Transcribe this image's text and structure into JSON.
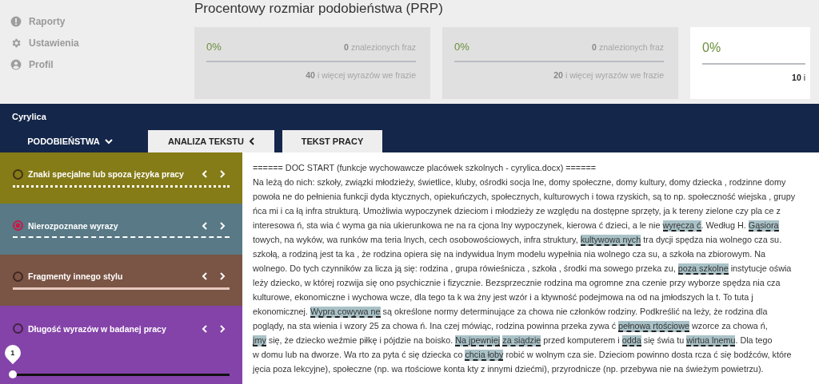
{
  "sidebar": {
    "items": [
      {
        "label": "Raporty"
      },
      {
        "label": "Ustawienia"
      },
      {
        "label": "Profil"
      }
    ]
  },
  "prp": {
    "title": "Procentowy rozmiar podobieństwa (PRP)",
    "cards": [
      {
        "percent": "0%",
        "found_count": "0",
        "found_label": "znalezionych fraz",
        "min_words": "40",
        "min_label": "i więcej wyrazów we frazie",
        "selected": false
      },
      {
        "percent": "0%",
        "found_count": "0",
        "found_label": "znalezionych fraz",
        "min_words": "20",
        "min_label": "i więcej wyrazów we frazie",
        "selected": false
      },
      {
        "percent": "0%",
        "min_words": "10",
        "min_label": "i",
        "selected": true
      }
    ]
  },
  "band": {
    "title": "Cyrylica"
  },
  "tabs": [
    {
      "label": "PODOBIEŃSTWA",
      "selected": true
    },
    {
      "label": "ANALIZA TEKSTU",
      "selected": false
    },
    {
      "label": "TEKST PRACY",
      "selected": false
    }
  ],
  "categories": [
    {
      "kind": "line",
      "label": "Znaki specjalne lub spoza języka pracy",
      "color": "#857b17",
      "selected": false
    },
    {
      "kind": "line",
      "label": "Nierozpoznane wyrazy",
      "color": "#587985",
      "selected": true
    },
    {
      "kind": "line",
      "label": "Fragmenty innego stylu",
      "color": "#7a5444",
      "selected": false
    },
    {
      "kind": "slider",
      "label": "Długość wyrazów w badanej pracy",
      "color": "#8443a9",
      "thumb_label": "1",
      "level": 0,
      "selected": false
    }
  ],
  "document": {
    "lines": [
      [
        {
          "t": "====== DOC START (funkcje wychowawcze placówek szkolnych - cyrylica.docx) ======"
        }
      ],
      [
        {
          "t": "Na leżą do nich: szkoły, związki młodzieży, świetlice, kluby, ośrodki socja lne, domy społeczne, domy kultury, domy dziecka , rodzinne domy"
        }
      ],
      [
        {
          "t": "powoła ne do pełnienia funkcji dyda ktycznych, opiekuńczych, społecznych, kulturowych i towa rzyskich, są to np. społeczność wiejska , grupy"
        }
      ],
      [
        {
          "t": "ńca mi i ca łą infra strukturą. Umożliwia wypoczynek dzieciom i młodzieży ze względu na dostępne sprzęty, ja k tereny zielone czy pla ce z"
        }
      ],
      [
        {
          "t": "interesowa ń, sta wia ć wyma ga nia ukierunkowa ne na ra cjona lny wypoczynek, kierowa ć dzieci, a le nie "
        },
        {
          "t": "wyręcza ć",
          "hl": true
        },
        {
          "t": ". Według H. "
        },
        {
          "t": "Gąsiora",
          "hl": true
        }
      ],
      [
        {
          "t": "towych, na wyków, wa runków ma teria lnych, cech osobowościowych, infra struktury, "
        },
        {
          "t": "kultywowa nych",
          "hl": true
        },
        {
          "t": " tra dycji spędza nia wolnego cza su."
        }
      ],
      [
        {
          "t": "szkołą, a rodziną jest ta ka , że rodzina opiera się na indywidua lnym modelu wypełnia nia wolnego cza su, a szkoła na zbiorowym. Na"
        }
      ],
      [
        {
          "t": "wolnego. Do tych czynników za licza ją się: rodzina , grupa rówieśnicza , szkoła , środki ma sowego przeka zu, "
        },
        {
          "t": "poza szkolne",
          "hl": true
        },
        {
          "t": " instytucje oświa"
        }
      ],
      [
        {
          "t": "leży dziecko, w której rozwija się ono psychicznie i fizycznie. Bezsprzecznie rodzina ma ogromne zna czenie przy wyborze spędza nia cza"
        }
      ],
      [
        {
          "t": "kulturowe, ekonomiczne i wychowa wcze, dla tego ta k wa żny jest wzór i a ktywność podejmowa na od na jmłodszych la t. To tuta j"
        }
      ],
      [
        {
          "t": "ekonomicznej. "
        },
        {
          "t": "Wypra cowywa ne",
          "hl": true
        },
        {
          "t": " są określone normy determinujące za chowa nie członków rodziny. Podkreślić na leży, że rodzina dla"
        }
      ],
      [
        {
          "t": "poglądy, na sta wienia i wzory 25 za chowa ń. Ina czej mówiąc, rodzina powinna przeka zywa ć "
        },
        {
          "t": "pełnowa rtościowe",
          "hl": true
        },
        {
          "t": " wzorce za chowa ń,"
        }
      ],
      [
        {
          "t": "jmy",
          "hl": true
        },
        {
          "t": " się, że dziecko weźmie piłkę i pójdzie na boisko. "
        },
        {
          "t": "Na jpewniej",
          "hl": true
        },
        {
          "t": "za siądzie",
          "hl": true
        },
        {
          "t": " przed komputerem i "
        },
        {
          "t": "odda",
          "hl": true
        },
        {
          "t": " się świa tu "
        },
        {
          "t": "wirtua lnemu",
          "hl": true
        },
        {
          "t": ". Dla tego"
        }
      ],
      [
        {
          "t": "w domu lub na dworze. Wa rto za pyta ć się dziecka co "
        },
        {
          "t": "chcia łoby",
          "hl": true
        },
        {
          "t": " robić w wolnym cza sie. Dzieciom powinno dosta rcza ć się bodźców, które"
        }
      ],
      [
        {
          "t": "jęcia poza lekcyjne), społeczne (np. wa rtościowe konta kty z innymi dziećmi), przyrodnicze (np. przebywa nie na świeżym powietrzu)."
        }
      ]
    ]
  }
}
